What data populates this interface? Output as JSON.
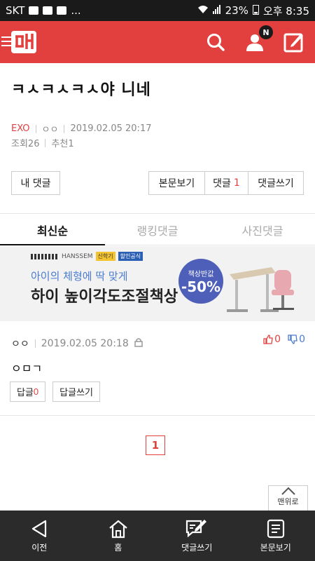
{
  "status": {
    "carrier": "SKT",
    "battery": "23%",
    "time": "오후 8:35",
    "dots": "..."
  },
  "appbar": {
    "badge": "N"
  },
  "post": {
    "title": "ㅋㅅㅋㅅㅋㅅ야 니네",
    "category": "EXO",
    "author": "ㅇㅇ",
    "datetime": "2019.02.05 20:17",
    "views_label": "조회26",
    "recommend_label": "추천1"
  },
  "actions": {
    "my_comments": "내 댓글",
    "view_post": "본문보기",
    "comments_label": "댓글",
    "comments_count": "1",
    "write_comment": "댓글쓰기"
  },
  "tabs": [
    {
      "label": "최신순",
      "active": true
    },
    {
      "label": "랭킹댓글",
      "active": false
    },
    {
      "label": "사진댓글",
      "active": false
    }
  ],
  "ad": {
    "brand": "HANSSEM",
    "tag1": "신학기",
    "tag2": "할인공식",
    "sub": "아이의 체형에 딱 맞게",
    "main": "하이 높이각도조절책상",
    "circle_small": "책상반값",
    "circle_big": "-50%"
  },
  "comment": {
    "nick": "ㅇㅇ",
    "datetime": "2019.02.05 20:18",
    "up": "0",
    "down": "0",
    "body": "ㅇㅁㄱ",
    "reply_label": "답글",
    "reply_count": "0",
    "write_reply": "답글쓰기"
  },
  "pager": {
    "current": "1"
  },
  "top_button": "맨위로",
  "bottom_nav": [
    {
      "label": "이전",
      "icon": "back-icon"
    },
    {
      "label": "홈",
      "icon": "home-icon"
    },
    {
      "label": "댓글쓰기",
      "icon": "comment-write-icon"
    },
    {
      "label": "본문보기",
      "icon": "document-icon"
    }
  ],
  "colors": {
    "brand_red": "#e2403f",
    "dark": "#2b2b2b"
  }
}
